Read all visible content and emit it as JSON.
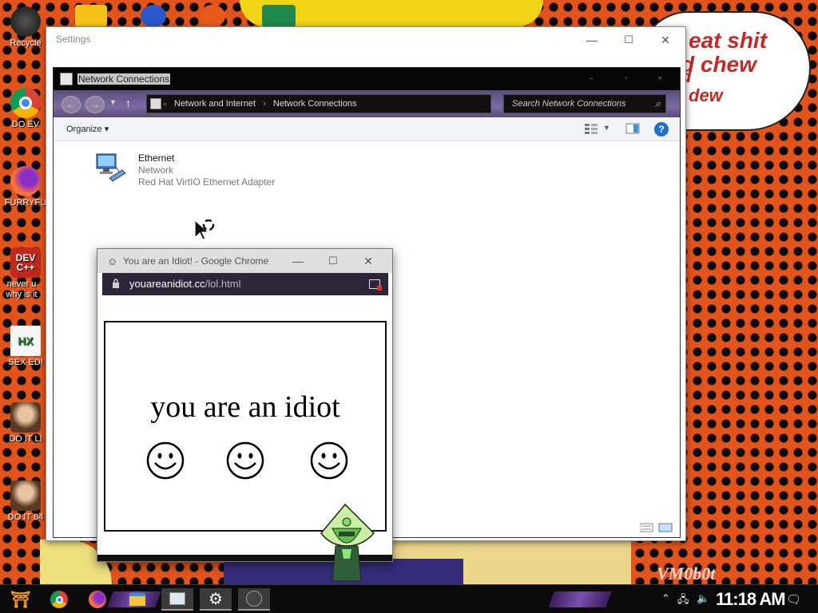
{
  "desktop": {
    "bubble_lines": [
      "eat shit",
      "d chew",
      "d",
      "dew"
    ],
    "watermark": "VM0b0t",
    "icons": [
      {
        "label": "Recycle",
        "icon": "recycle-bin-icon"
      },
      {
        "label": "DO EV",
        "icon": "chrome-icon"
      },
      {
        "label": "FURRYFU",
        "icon": "firefox-icon"
      },
      {
        "label": "never u why is it",
        "icon": "dev-cpp-icon"
      },
      {
        "label": "SEX EDI",
        "icon": "hex-editor-icon"
      },
      {
        "label": "DO IT LI",
        "icon": "portrait-icon"
      },
      {
        "label": "DO IT 64",
        "icon": "portrait-icon"
      }
    ]
  },
  "settings": {
    "title": "Settings",
    "minimize": "—",
    "maximize": "☐",
    "close": "✕"
  },
  "network_connections": {
    "title": "Network Connections",
    "breadcrumb": [
      "Network and Internet",
      "Network Connections"
    ],
    "search_placeholder": "Search Network Connections",
    "organize": "Organize ▾",
    "help": "?",
    "adapter": {
      "name": "Ethernet",
      "network": "Network",
      "device": "Red Hat VirtIO Ethernet Adapter"
    }
  },
  "chrome": {
    "title": "You are an Idiot! - Google Chrome",
    "url_domain": "youareanidiot.cc",
    "url_path": "/lol.html",
    "minimize": "—",
    "maximize": "☐",
    "close": "✕",
    "page_text": "you are an idiot",
    "smiley_count": 3
  },
  "taskbar": {
    "clock": "11:18 AM",
    "items": [
      "start-icon",
      "chrome-icon",
      "firefox-icon",
      "file-explorer-icon",
      "network-connections-icon",
      "settings-icon",
      "character-icon"
    ]
  },
  "colors": {
    "background_orange": "#e3541c",
    "bubble_text": "#c62828",
    "address_bar_purple": "#6a5b92",
    "chrome_address": "#2c2638",
    "help_blue": "#1e6fd0"
  }
}
